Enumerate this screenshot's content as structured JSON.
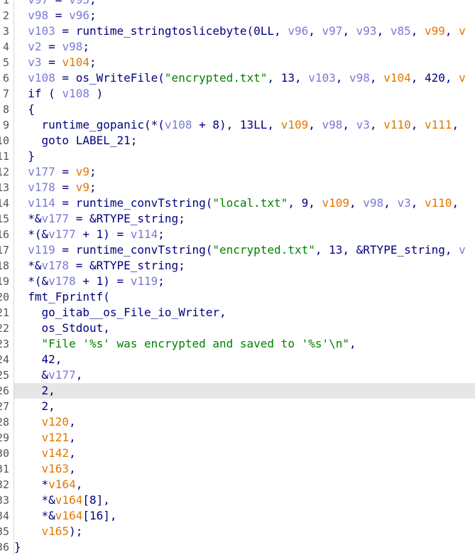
{
  "lines": [
    {
      "num": "1",
      "highlighted": false,
      "tokens": [
        {
          "t": "  ",
          "c": "d"
        },
        {
          "t": "v97",
          "c": "v"
        },
        {
          "t": " = ",
          "c": "d"
        },
        {
          "t": "v93",
          "c": "v"
        },
        {
          "t": ";",
          "c": "d"
        }
      ]
    },
    {
      "num": "2",
      "highlighted": false,
      "tokens": [
        {
          "t": "  ",
          "c": "d"
        },
        {
          "t": "v98",
          "c": "v"
        },
        {
          "t": " = ",
          "c": "d"
        },
        {
          "t": "v96",
          "c": "v"
        },
        {
          "t": ";",
          "c": "d"
        }
      ]
    },
    {
      "num": "3",
      "highlighted": false,
      "tokens": [
        {
          "t": "  ",
          "c": "d"
        },
        {
          "t": "v103",
          "c": "v"
        },
        {
          "t": " = runtime_stringtoslicebyte(0LL, ",
          "c": "d"
        },
        {
          "t": "v96",
          "c": "v"
        },
        {
          "t": ", ",
          "c": "d"
        },
        {
          "t": "v97",
          "c": "v"
        },
        {
          "t": ", ",
          "c": "d"
        },
        {
          "t": "v93",
          "c": "v"
        },
        {
          "t": ", ",
          "c": "d"
        },
        {
          "t": "v85",
          "c": "v"
        },
        {
          "t": ", ",
          "c": "d"
        },
        {
          "t": "v99",
          "c": "o"
        },
        {
          "t": ", ",
          "c": "d"
        },
        {
          "t": "v",
          "c": "o"
        }
      ]
    },
    {
      "num": "4",
      "highlighted": false,
      "tokens": [
        {
          "t": "  ",
          "c": "d"
        },
        {
          "t": "v2",
          "c": "v"
        },
        {
          "t": " = ",
          "c": "d"
        },
        {
          "t": "v98",
          "c": "v"
        },
        {
          "t": ";",
          "c": "d"
        }
      ]
    },
    {
      "num": "5",
      "highlighted": false,
      "tokens": [
        {
          "t": "  ",
          "c": "d"
        },
        {
          "t": "v3",
          "c": "v"
        },
        {
          "t": " = ",
          "c": "d"
        },
        {
          "t": "v104",
          "c": "o"
        },
        {
          "t": ";",
          "c": "d"
        }
      ]
    },
    {
      "num": "6",
      "highlighted": false,
      "tokens": [
        {
          "t": "  ",
          "c": "d"
        },
        {
          "t": "v108",
          "c": "v"
        },
        {
          "t": " = os_WriteFile(",
          "c": "d"
        },
        {
          "t": "\"encrypted.txt\"",
          "c": "s"
        },
        {
          "t": ", 13, ",
          "c": "d"
        },
        {
          "t": "v103",
          "c": "v"
        },
        {
          "t": ", ",
          "c": "d"
        },
        {
          "t": "v98",
          "c": "v"
        },
        {
          "t": ", ",
          "c": "d"
        },
        {
          "t": "v104",
          "c": "o"
        },
        {
          "t": ", 420, ",
          "c": "d"
        },
        {
          "t": "v",
          "c": "o"
        }
      ]
    },
    {
      "num": "7",
      "highlighted": false,
      "tokens": [
        {
          "t": "  if ( ",
          "c": "d"
        },
        {
          "t": "v108",
          "c": "v"
        },
        {
          "t": " )",
          "c": "d"
        }
      ]
    },
    {
      "num": "8",
      "highlighted": false,
      "tokens": [
        {
          "t": "  {",
          "c": "d"
        }
      ]
    },
    {
      "num": "9",
      "highlighted": false,
      "tokens": [
        {
          "t": "    runtime_gopanic(*(",
          "c": "d"
        },
        {
          "t": "v108",
          "c": "v"
        },
        {
          "t": " + 8), 13LL, ",
          "c": "d"
        },
        {
          "t": "v109",
          "c": "o"
        },
        {
          "t": ", ",
          "c": "d"
        },
        {
          "t": "v98",
          "c": "v"
        },
        {
          "t": ", ",
          "c": "d"
        },
        {
          "t": "v3",
          "c": "v"
        },
        {
          "t": ", ",
          "c": "d"
        },
        {
          "t": "v110",
          "c": "o"
        },
        {
          "t": ", ",
          "c": "d"
        },
        {
          "t": "v111",
          "c": "o"
        },
        {
          "t": ",",
          "c": "d"
        }
      ]
    },
    {
      "num": "10",
      "highlighted": false,
      "tokens": [
        {
          "t": "    goto LABEL_21;",
          "c": "d"
        }
      ]
    },
    {
      "num": "11",
      "highlighted": false,
      "tokens": [
        {
          "t": "  }",
          "c": "d"
        }
      ]
    },
    {
      "num": "12",
      "highlighted": false,
      "tokens": [
        {
          "t": "  ",
          "c": "d"
        },
        {
          "t": "v177",
          "c": "v"
        },
        {
          "t": " = ",
          "c": "d"
        },
        {
          "t": "v9",
          "c": "o"
        },
        {
          "t": ";",
          "c": "d"
        }
      ]
    },
    {
      "num": "13",
      "highlighted": false,
      "tokens": [
        {
          "t": "  ",
          "c": "d"
        },
        {
          "t": "v178",
          "c": "v"
        },
        {
          "t": " = ",
          "c": "d"
        },
        {
          "t": "v9",
          "c": "o"
        },
        {
          "t": ";",
          "c": "d"
        }
      ]
    },
    {
      "num": "14",
      "highlighted": false,
      "tokens": [
        {
          "t": "  ",
          "c": "d"
        },
        {
          "t": "v114",
          "c": "v"
        },
        {
          "t": " = runtime_convTstring(",
          "c": "d"
        },
        {
          "t": "\"local.txt\"",
          "c": "s"
        },
        {
          "t": ", 9, ",
          "c": "d"
        },
        {
          "t": "v109",
          "c": "o"
        },
        {
          "t": ", ",
          "c": "d"
        },
        {
          "t": "v98",
          "c": "v"
        },
        {
          "t": ", ",
          "c": "d"
        },
        {
          "t": "v3",
          "c": "v"
        },
        {
          "t": ", ",
          "c": "d"
        },
        {
          "t": "v110",
          "c": "o"
        },
        {
          "t": ",",
          "c": "d"
        }
      ]
    },
    {
      "num": "15",
      "highlighted": false,
      "tokens": [
        {
          "t": "  *&",
          "c": "d"
        },
        {
          "t": "v177",
          "c": "v"
        },
        {
          "t": " = &RTYPE_string;",
          "c": "d"
        }
      ]
    },
    {
      "num": "16",
      "highlighted": false,
      "tokens": [
        {
          "t": "  *(&",
          "c": "d"
        },
        {
          "t": "v177",
          "c": "v"
        },
        {
          "t": " + 1) = ",
          "c": "d"
        },
        {
          "t": "v114",
          "c": "v"
        },
        {
          "t": ";",
          "c": "d"
        }
      ]
    },
    {
      "num": "17",
      "highlighted": false,
      "tokens": [
        {
          "t": "  ",
          "c": "d"
        },
        {
          "t": "v119",
          "c": "v"
        },
        {
          "t": " = runtime_convTstring(",
          "c": "d"
        },
        {
          "t": "\"encrypted.txt\"",
          "c": "s"
        },
        {
          "t": ", 13, &RTYPE_string, ",
          "c": "d"
        },
        {
          "t": "v",
          "c": "v"
        }
      ]
    },
    {
      "num": "18",
      "highlighted": false,
      "tokens": [
        {
          "t": "  *&",
          "c": "d"
        },
        {
          "t": "v178",
          "c": "v"
        },
        {
          "t": " = &RTYPE_string;",
          "c": "d"
        }
      ]
    },
    {
      "num": "19",
      "highlighted": false,
      "tokens": [
        {
          "t": "  *(&",
          "c": "d"
        },
        {
          "t": "v178",
          "c": "v"
        },
        {
          "t": " + 1) = ",
          "c": "d"
        },
        {
          "t": "v119",
          "c": "v"
        },
        {
          "t": ";",
          "c": "d"
        }
      ]
    },
    {
      "num": "20",
      "highlighted": false,
      "tokens": [
        {
          "t": "  fmt_Fprintf(",
          "c": "d"
        }
      ]
    },
    {
      "num": "21",
      "highlighted": false,
      "tokens": [
        {
          "t": "    go_itab__os_File_io_Writer,",
          "c": "d"
        }
      ]
    },
    {
      "num": "22",
      "highlighted": false,
      "tokens": [
        {
          "t": "    os_Stdout,",
          "c": "d"
        }
      ]
    },
    {
      "num": "23",
      "highlighted": false,
      "tokens": [
        {
          "t": "    ",
          "c": "d"
        },
        {
          "t": "\"File '%s' was encrypted and saved to '%s'\\n\"",
          "c": "s"
        },
        {
          "t": ",",
          "c": "d"
        }
      ]
    },
    {
      "num": "24",
      "highlighted": false,
      "tokens": [
        {
          "t": "    42,",
          "c": "d"
        }
      ]
    },
    {
      "num": "25",
      "highlighted": false,
      "tokens": [
        {
          "t": "    &",
          "c": "d"
        },
        {
          "t": "v177",
          "c": "v"
        },
        {
          "t": ",",
          "c": "d"
        }
      ]
    },
    {
      "num": "26",
      "highlighted": true,
      "tokens": [
        {
          "t": "    2,",
          "c": "d"
        }
      ]
    },
    {
      "num": "27",
      "highlighted": false,
      "tokens": [
        {
          "t": "    2,",
          "c": "d"
        }
      ]
    },
    {
      "num": "28",
      "highlighted": false,
      "tokens": [
        {
          "t": "    ",
          "c": "d"
        },
        {
          "t": "v120",
          "c": "o"
        },
        {
          "t": ",",
          "c": "d"
        }
      ]
    },
    {
      "num": "29",
      "highlighted": false,
      "tokens": [
        {
          "t": "    ",
          "c": "d"
        },
        {
          "t": "v121",
          "c": "o"
        },
        {
          "t": ",",
          "c": "d"
        }
      ]
    },
    {
      "num": "30",
      "highlighted": false,
      "tokens": [
        {
          "t": "    ",
          "c": "d"
        },
        {
          "t": "v142",
          "c": "o"
        },
        {
          "t": ",",
          "c": "d"
        }
      ]
    },
    {
      "num": "31",
      "highlighted": false,
      "tokens": [
        {
          "t": "    ",
          "c": "d"
        },
        {
          "t": "v163",
          "c": "o"
        },
        {
          "t": ",",
          "c": "d"
        }
      ]
    },
    {
      "num": "32",
      "highlighted": false,
      "tokens": [
        {
          "t": "    *",
          "c": "d"
        },
        {
          "t": "v164",
          "c": "o"
        },
        {
          "t": ",",
          "c": "d"
        }
      ]
    },
    {
      "num": "33",
      "highlighted": false,
      "tokens": [
        {
          "t": "    *&",
          "c": "d"
        },
        {
          "t": "v164",
          "c": "o"
        },
        {
          "t": "[8],",
          "c": "d"
        }
      ]
    },
    {
      "num": "34",
      "highlighted": false,
      "tokens": [
        {
          "t": "    *&",
          "c": "d"
        },
        {
          "t": "v164",
          "c": "o"
        },
        {
          "t": "[16],",
          "c": "d"
        }
      ]
    },
    {
      "num": "35",
      "highlighted": false,
      "tokens": [
        {
          "t": "    ",
          "c": "d"
        },
        {
          "t": "v165",
          "c": "o"
        },
        {
          "t": ");",
          "c": "d"
        }
      ]
    },
    {
      "num": "36",
      "highlighted": false,
      "tokens": [
        {
          "t": "}",
          "c": "d"
        }
      ]
    }
  ],
  "colors": {
    "default": "#000080",
    "local_var": "#7a7ad4",
    "global_var": "#e07800",
    "string": "#008000",
    "highlight_row": "#e6e6e6",
    "gutter_text": "#555555"
  }
}
